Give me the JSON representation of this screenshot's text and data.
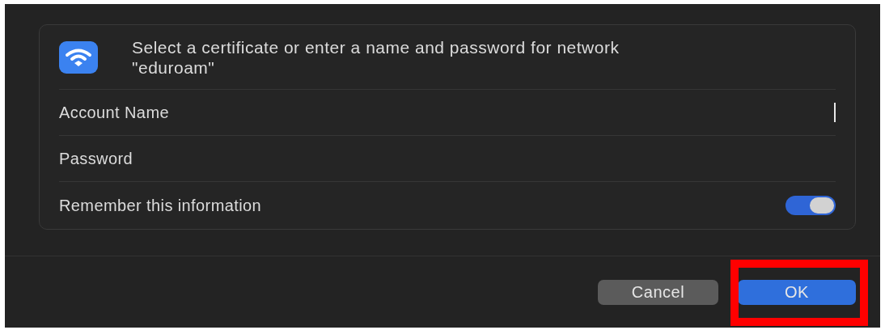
{
  "dialog": {
    "message": "Select a certificate or enter a name and password for network \"eduroam\"",
    "fields": [
      {
        "label": "Account Name",
        "focused": true
      },
      {
        "label": "Password",
        "focused": false
      }
    ],
    "remember": {
      "label": "Remember this information",
      "on": true
    },
    "buttons": [
      {
        "label": "Cancel",
        "kind": "secondary",
        "highlighted": false
      },
      {
        "label": "OK",
        "kind": "primary",
        "highlighted": true
      }
    ]
  }
}
